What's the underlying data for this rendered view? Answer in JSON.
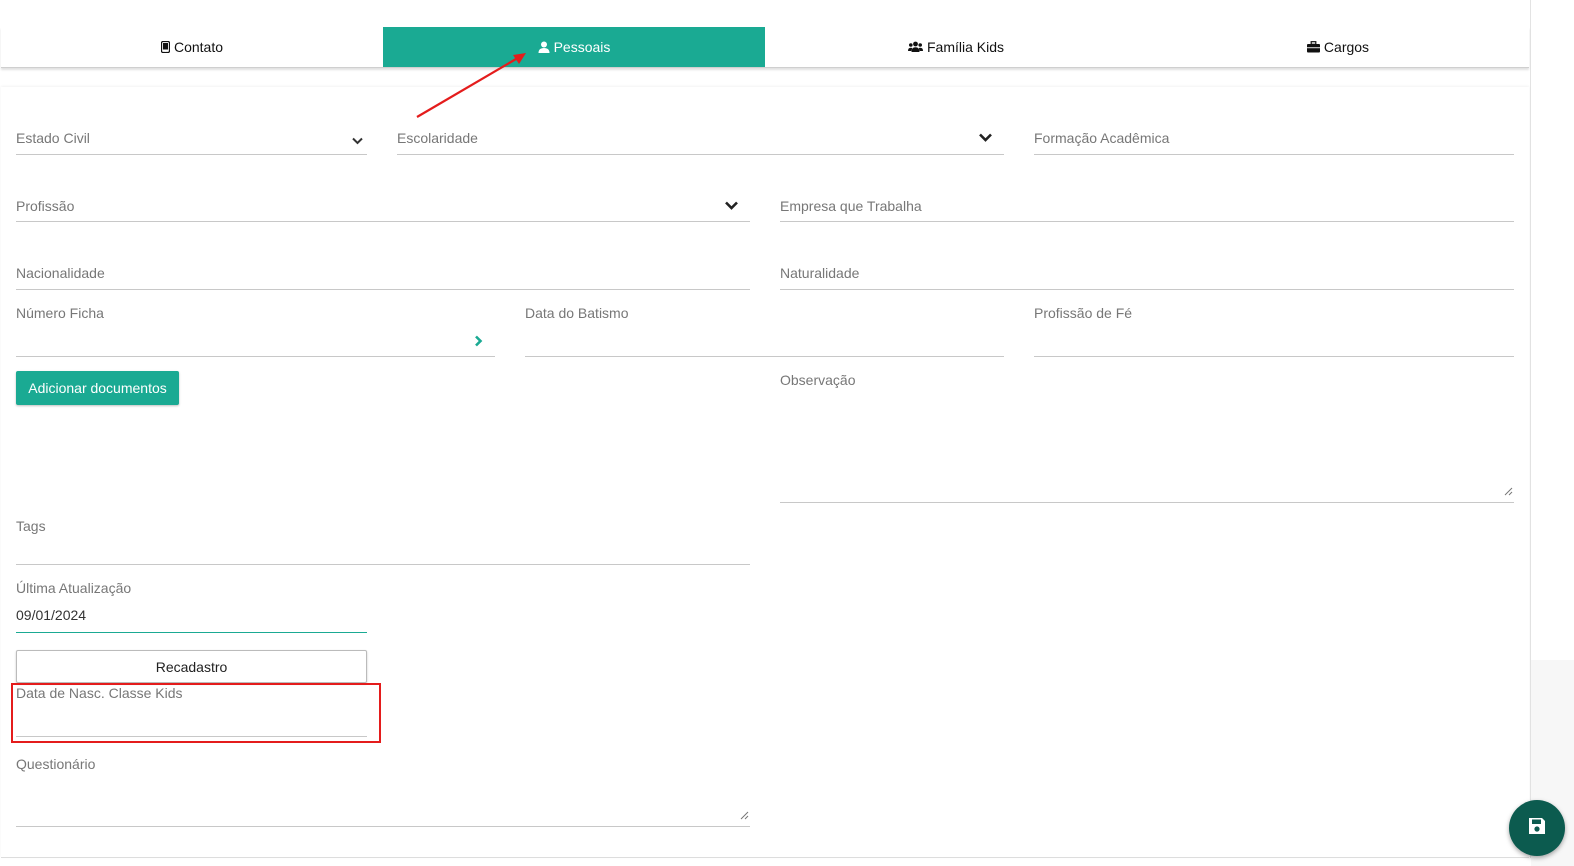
{
  "tabs": [
    {
      "label": "Contato",
      "icon": "mobile-icon"
    },
    {
      "label": "Pessoais",
      "icon": "user-icon",
      "active": true
    },
    {
      "label": "Família Kids",
      "icon": "users-icon"
    },
    {
      "label": "Cargos",
      "icon": "briefcase-icon"
    }
  ],
  "form": {
    "estado_civil": "Estado Civil",
    "escolaridade": "Escolaridade",
    "formacao_academica": "Formação Acadêmica",
    "profissao": "Profissão",
    "empresa": "Empresa que Trabalha",
    "nacionalidade": "Nacionalidade",
    "naturalidade": "Naturalidade",
    "numero_ficha": "Número Ficha",
    "data_batismo": "Data do Batismo",
    "profissao_fe": "Profissão de Fé",
    "add_documents": "Adicionar documentos",
    "observacao": "Observação",
    "tags": "Tags",
    "ultima_atualizacao_label": "Última Atualização",
    "ultima_atualizacao_value": "09/01/2024",
    "recadastro": "Recadastro",
    "data_nasc_classe_kids": "Data de Nasc. Classe Kids",
    "questionario": "Questionário"
  },
  "colors": {
    "accent": "#1aaa93",
    "fab": "#0c5b4f",
    "annotation": "#e41c1c"
  },
  "fab_icon": "save-icon"
}
